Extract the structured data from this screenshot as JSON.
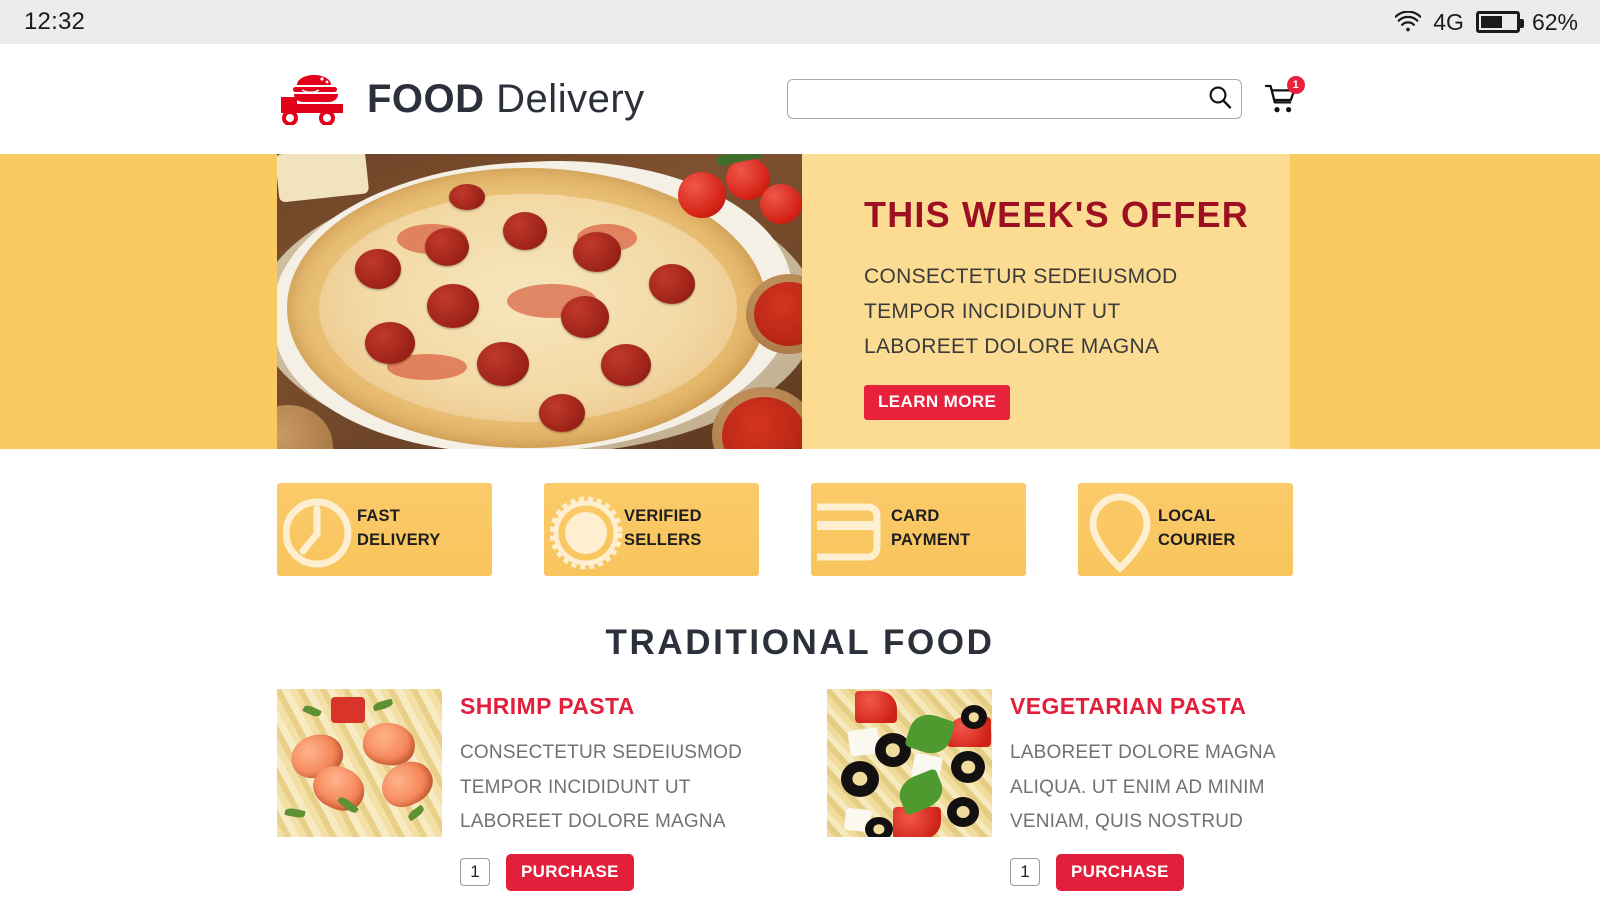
{
  "statusbar": {
    "time": "12:32",
    "network": "4G",
    "battery_percent": "62%",
    "battery_level": 62,
    "wifi_icon": "wifi-icon",
    "battery_icon": "battery-icon"
  },
  "header": {
    "logo": {
      "icon": "delivery-truck-icon",
      "text_bold": "FOOD",
      "text_light": "Delivery"
    },
    "search": {
      "value": "",
      "placeholder": "",
      "icon": "search-icon"
    },
    "cart": {
      "icon": "shopping-cart-icon",
      "badge_count": "1"
    }
  },
  "hero": {
    "image_alt": "pepperoni-pizza-photo",
    "title": "THIS WEEK'S OFFER",
    "lines": [
      "CONSECTETUR SEDEIUSMOD",
      "TEMPOR INCIDIDUNT UT",
      "LABOREET DOLORE MAGNA"
    ],
    "cta_label": "LEARN MORE",
    "colors": {
      "band": "#F8CA61",
      "panel": "#FCDC92",
      "title": "#9C1021",
      "cta": "#E8213C"
    }
  },
  "features": [
    {
      "icon": "clock-icon",
      "line1": "FAST",
      "line2": "DELIVERY"
    },
    {
      "icon": "badge-seal-icon",
      "line1": "VERIFIED",
      "line2": "SELLERS"
    },
    {
      "icon": "credit-card-icon",
      "line1": "CARD",
      "line2": "PAYMENT"
    },
    {
      "icon": "map-pin-icon",
      "line1": "LOCAL",
      "line2": "COURIER"
    }
  ],
  "traditional": {
    "heading": "TRADITIONAL FOOD",
    "products": [
      {
        "image_alt": "shrimp-pasta-photo",
        "title": "SHRIMP PASTA",
        "lines": [
          "CONSECTETUR SEDEIUSMOD",
          "TEMPOR INCIDIDUNT UT",
          "LABOREET DOLORE MAGNA"
        ],
        "quantity": "1",
        "purchase_label": "PURCHASE"
      },
      {
        "image_alt": "vegetarian-pasta-photo",
        "title": "VEGETARIAN PASTA",
        "lines": [
          "LABOREET DOLORE MAGNA",
          "ALIQUA. UT ENIM AD MINIM",
          "VENIAM, QUIS NOSTRUD"
        ],
        "quantity": "1",
        "purchase_label": "PURCHASE"
      }
    ]
  },
  "theme": {
    "brand_red": "#E2203C",
    "brand_yellow": "#F8CA61",
    "dark_navy": "#2B303B",
    "body_gray": "#6F7174"
  }
}
